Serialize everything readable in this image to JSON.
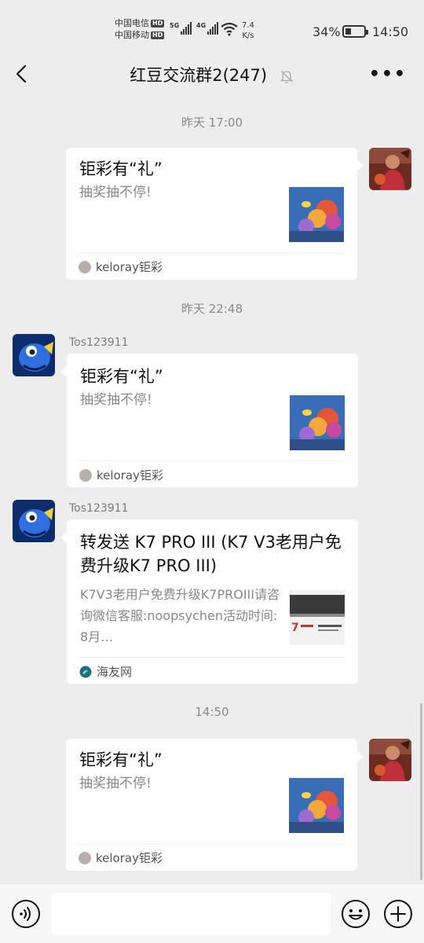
{
  "status": {
    "carrier1": "中国电信",
    "carrier2": "中国移动",
    "hd": "HD",
    "sig1": "5G",
    "sig2": "4G",
    "net_speed_value": "7.4",
    "net_speed_unit": "K/s",
    "battery": "34%",
    "battery_level": 0.34,
    "time": "14:50"
  },
  "header": {
    "title": "红豆交流群2(247)"
  },
  "messages": [
    {
      "time": "昨天 17:00",
      "side": "right",
      "title": "钜彩有“礼”",
      "desc": "抽奖抽不停!",
      "source": "keloray钜彩"
    },
    {
      "time": "昨天 22:48",
      "side": "left",
      "sender": "Tos123911",
      "title": "钜彩有“礼”",
      "desc": "抽奖抽不停!",
      "source": "keloray钜彩"
    },
    {
      "side": "left",
      "sender": "Tos123911",
      "title": "转发送 K7 PRO III (K7 V3老用户免费升级K7 PRO III)",
      "desc": "K7V3老用户免费升级K7PROIII请咨询微信客服:noopsychen活动时间: 8月…",
      "source": "海友网"
    },
    {
      "time": "14:50",
      "side": "right",
      "title": "钜彩有“礼”",
      "desc": "抽奖抽不停!",
      "source": "keloray钜彩"
    }
  ],
  "input": {
    "value": "",
    "placeholder": ""
  },
  "icons": {
    "back": "chevron-left-icon",
    "mute": "bell-off-icon",
    "more": "more-icon",
    "voice": "voice-icon",
    "emoji": "emoji-icon",
    "plus": "plus-icon"
  }
}
